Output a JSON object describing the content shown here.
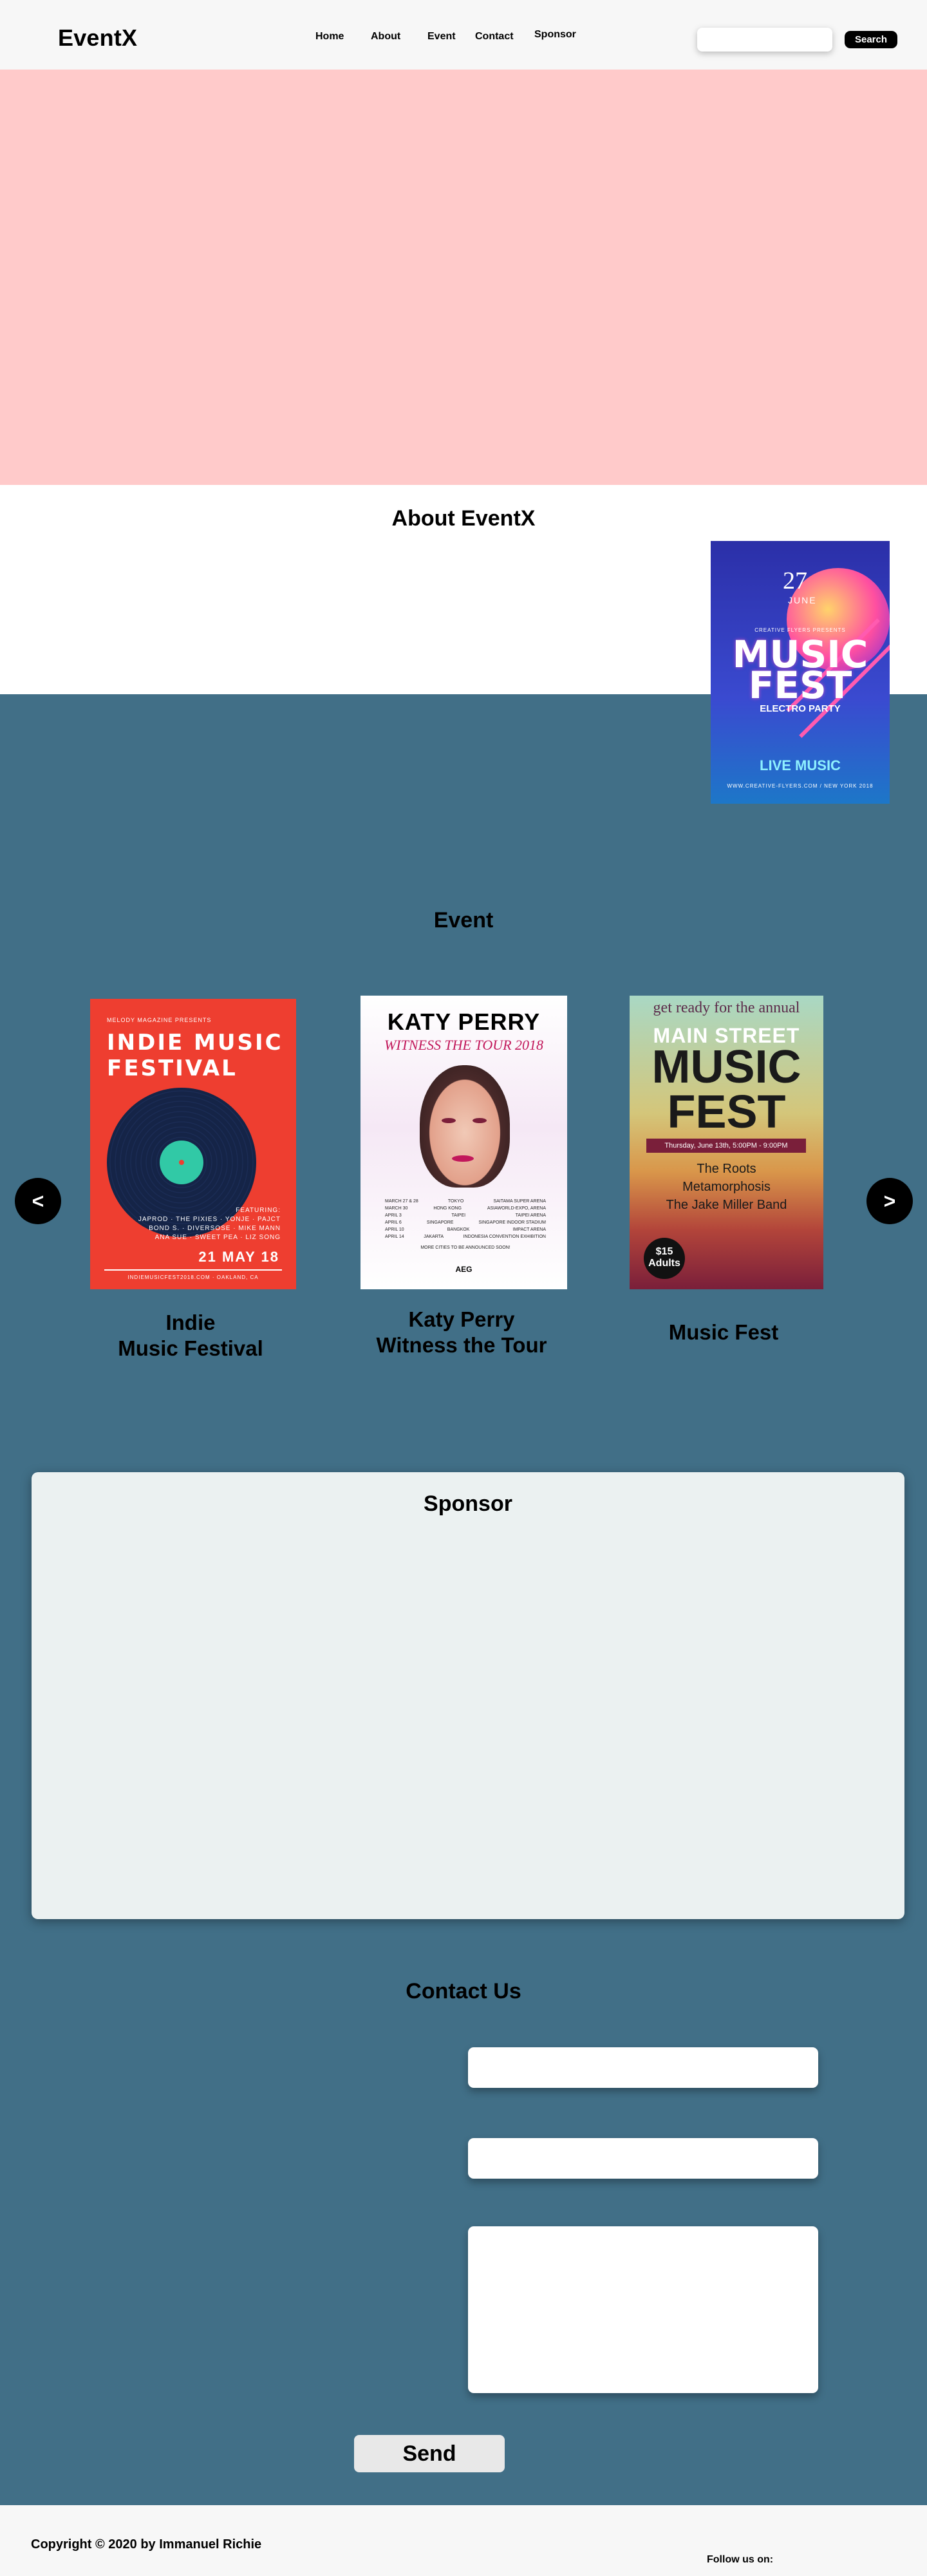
{
  "navbar": {
    "brand": "EventX",
    "links": [
      "Home",
      "About",
      "Event",
      "Contact",
      "Sponsor"
    ],
    "search_placeholder": "",
    "search_button": "Search"
  },
  "about": {
    "title": "About EventX",
    "poster": {
      "date": "27",
      "month": "JUNE",
      "presents": "CREATIVE FLYERS PRESENTS",
      "line1": "MUSIC",
      "line2": "FEST",
      "subtitle": "ELECTRO PARTY",
      "tagline": "LIVE MUSIC",
      "url": "WWW.CREATIVE-FLYERS.COM / NEW YORK 2018"
    }
  },
  "event": {
    "title": "Event",
    "prev_label": "<",
    "next_label": ">",
    "cards": [
      {
        "caption_line1": "Indie",
        "caption_line2": "Music Festival",
        "poster": {
          "top": "MELODY MAGAZINE PRESENTS",
          "title_line1": "INDIE MUSIC",
          "title_line2": "FESTIVAL",
          "featuring": "FEATURING:",
          "artists1": "JAPROD · THE PIXIES · YONJE · PAJCT",
          "artists2": "BOND S. · DIVERSOSE · MIKE MANN",
          "artists3": "ANA SUE · SWEET PEA · LIZ SONG",
          "date": "21 MAY 18",
          "url": "INDIEMUSICFEST2018.COM · OAKLAND, CA"
        }
      },
      {
        "caption_line1": "Katy Perry",
        "caption_line2": "Witness the Tour",
        "poster": {
          "title": "KATY PERRY",
          "subtitle": "WITNESS THE TOUR 2018",
          "dates": [
            [
              "MARCH 27 & 28",
              "TOKYO",
              "SAITAMA SUPER ARENA"
            ],
            [
              "MARCH 30",
              "HONG KONG",
              "ASIAWORLD-EXPO, ARENA"
            ],
            [
              "APRIL 3",
              "TAIPEI",
              "TAIPEI ARENA"
            ],
            [
              "APRIL 6",
              "SINGAPORE",
              "SINGAPORE INDOOR STADIUM"
            ],
            [
              "APRIL 10",
              "BANGKOK",
              "IMPACT ARENA"
            ],
            [
              "APRIL 14",
              "JAKARTA",
              "INDONESIA CONVENTION EXHIBITION"
            ]
          ],
          "more": "MORE CITIES TO BE ANNOUNCED SOON!",
          "promoter": "AEG"
        }
      },
      {
        "caption_line1": "Music Fest",
        "caption_line2": "",
        "poster": {
          "get_ready": "get ready for the annual",
          "main": "MAIN STREET",
          "music": "MUSIC",
          "fest": "FEST",
          "date": "Thursday, June 13th, 5:00PM - 9:00PM",
          "band1": "The Roots",
          "band2": "Metamorphosis",
          "band3": "The Jake Miller Band",
          "price": "$15",
          "price_label": "Adults"
        }
      }
    ]
  },
  "sponsor": {
    "title": "Sponsor"
  },
  "contact": {
    "title": "Contact Us",
    "send_label": "Send"
  },
  "footer": {
    "copyright": "Copyright © 2020 by Immanuel Richie",
    "follow": "Follow us on:"
  },
  "colors": {
    "hero": "#ffcaca",
    "section": "#416f87",
    "sponsor_card": "#ebf1f1",
    "nav_bg": "#f7f7f7"
  }
}
